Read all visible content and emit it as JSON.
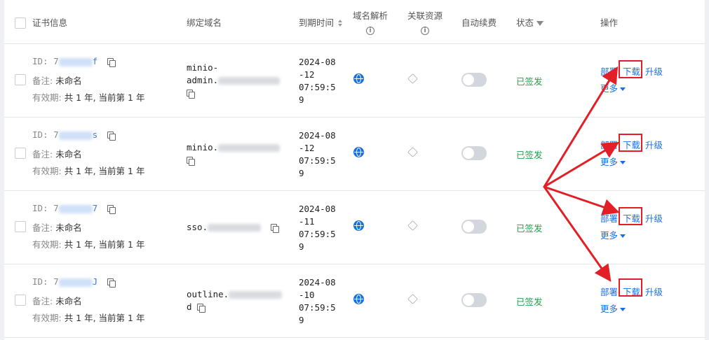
{
  "columns": {
    "cert_info": "证书信息",
    "bound_domain": "绑定域名",
    "expire_time": "到期时间",
    "dns": "域名解析",
    "related": "关联资源",
    "auto_renew": "自动续费",
    "status": "状态",
    "actions": "操作"
  },
  "rows": [
    {
      "id_prefix": "ID: 7",
      "id_suffix": "f",
      "note_label": "备注:",
      "note_value": "未命名",
      "validity_label": "有效期:",
      "validity_value": "共 1 年, 当前第 1 年",
      "domain_line1": "minio-",
      "domain_line2": "admin.",
      "expire": "2024-08\n-12\n07:59:5\n9",
      "status": "已签发",
      "deploy": "部署",
      "download": "下载",
      "upgrade": "升级",
      "more": "更多"
    },
    {
      "id_prefix": "ID: 7",
      "id_suffix": "s",
      "note_label": "备注:",
      "note_value": "未命名",
      "validity_label": "有效期:",
      "validity_value": "共 1 年, 当前第 1 年",
      "domain_line1": "minio.",
      "domain_line2": "",
      "expire": "2024-08\n-12\n07:59:5\n9",
      "status": "已签发",
      "deploy": "部署",
      "download": "下载",
      "upgrade": "升级",
      "more": "更多"
    },
    {
      "id_prefix": "ID: 7",
      "id_suffix": "7",
      "note_label": "备注:",
      "note_value": "未命名",
      "validity_label": "有效期:",
      "validity_value": "共 1 年, 当前第 1 年",
      "domain_line1": "sso.",
      "domain_line2": "",
      "expire": "2024-08\n-11\n07:59:5\n9",
      "status": "已签发",
      "deploy": "部署",
      "download": "下载",
      "upgrade": "升级",
      "more": "更多"
    },
    {
      "id_prefix": "ID: 7",
      "id_suffix": "J",
      "note_label": "备注:",
      "note_value": "未命名",
      "validity_label": "有效期:",
      "validity_value": "共 1 年, 当前第 1 年",
      "domain_line1": "outline.",
      "domain_line2": "d",
      "expire": "2024-08\n-10\n07:59:5\n9",
      "status": "已签发",
      "deploy": "部署",
      "download": "下载",
      "upgrade": "升级",
      "more": "更多"
    }
  ],
  "colors": {
    "accent": "#1a6fe0",
    "status_green": "#22a04b",
    "annotation_red": "#e21f26"
  }
}
